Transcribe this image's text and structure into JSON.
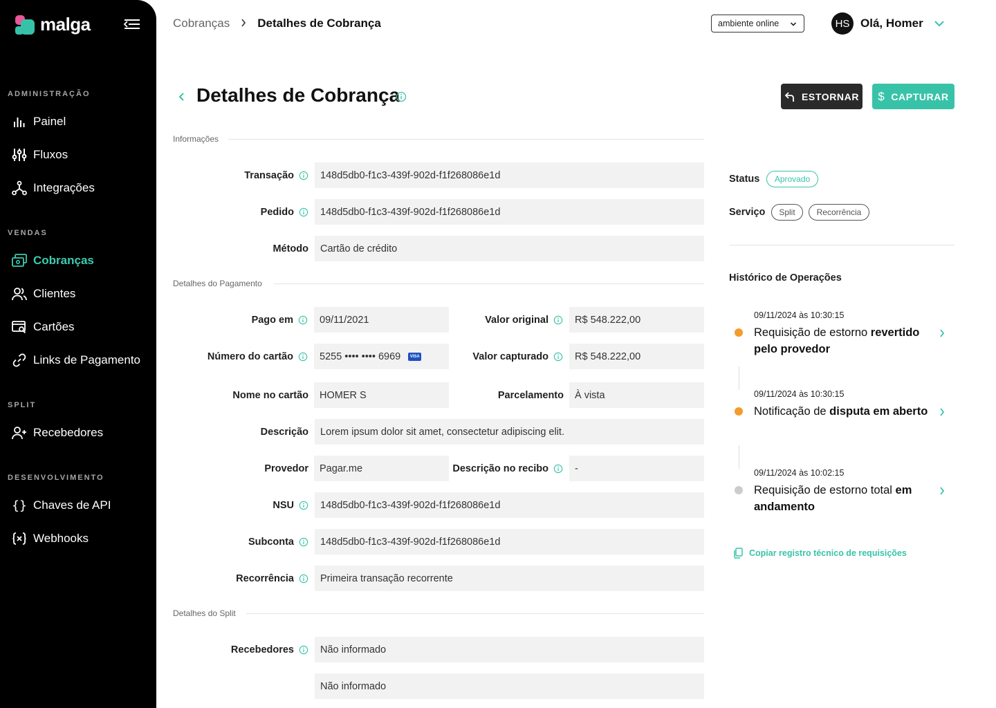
{
  "app": {
    "logo_text": "malga"
  },
  "sidebar": {
    "sections": [
      {
        "label": "ADMINISTRAÇÃO"
      },
      {
        "label": "VENDAS"
      },
      {
        "label": "SPLIT"
      },
      {
        "label": "DESENVOLVIMENTO"
      }
    ],
    "items": [
      {
        "label": "Painel",
        "icon": "bar-chart-icon"
      },
      {
        "label": "Fluxos",
        "icon": "sliders-icon"
      },
      {
        "label": "Integrações",
        "icon": "integrations-icon"
      },
      {
        "label": "Cobranças",
        "icon": "charges-icon",
        "active": true
      },
      {
        "label": "Clientes",
        "icon": "users-icon"
      },
      {
        "label": "Cartões",
        "icon": "card-search-icon"
      },
      {
        "label": "Links de Pagamento",
        "icon": "link-icon"
      },
      {
        "label": "Recebedores",
        "icon": "user-plus-icon"
      },
      {
        "label": "Chaves de API",
        "icon": "braces-icon"
      },
      {
        "label": "Webhooks",
        "icon": "webhook-icon"
      }
    ]
  },
  "header": {
    "breadcrumb": {
      "parent": "Cobranças",
      "current": "Detalhes de Cobrança"
    },
    "environment": "ambiente online",
    "user": {
      "initials": "HS",
      "greeting": "Olá, Homer"
    }
  },
  "page": {
    "title": "Detalhes de Cobrança",
    "actions": {
      "estornar": "ESTORNAR",
      "capturar": "CAPTURAR"
    }
  },
  "info": {
    "section_title": "Informações",
    "transacao": {
      "label": "Transação",
      "value": "148d5db0-f1c3-439f-902d-f1f268086e1d"
    },
    "pedido": {
      "label": "Pedido",
      "value": "148d5db0-f1c3-439f-902d-f1f268086e1d"
    },
    "metodo": {
      "label": "Método",
      "value": "Cartão de crédito"
    }
  },
  "payment": {
    "section_title": "Detalhes do Pagamento",
    "pago_em": {
      "label": "Pago em",
      "value": "09/11/2021"
    },
    "valor_original": {
      "label": "Valor original",
      "value": "R$ 548.222,00"
    },
    "numero_cartao": {
      "label": "Número do cartão",
      "value": "5255 •••• •••• 6969",
      "brand": "VISA"
    },
    "valor_capturado": {
      "label": "Valor capturado",
      "value": "R$ 548.222,00"
    },
    "nome_cartao": {
      "label": "Nome no cartão",
      "value": "HOMER S"
    },
    "parcelamento": {
      "label": "Parcelamento",
      "value": "À vista"
    },
    "descricao": {
      "label": "Descrição",
      "value": "Lorem ipsum dolor sit amet, consectetur adipiscing elit."
    },
    "provedor": {
      "label": "Provedor",
      "value": "Pagar.me"
    },
    "descricao_recibo": {
      "label": "Descrição no recibo",
      "value": "-"
    },
    "nsu": {
      "label": "NSU",
      "value": "148d5db0-f1c3-439f-902d-f1f268086e1d"
    },
    "subconta": {
      "label": "Subconta",
      "value": "148d5db0-f1c3-439f-902d-f1f268086e1d"
    },
    "recorrencia": {
      "label": "Recorrência",
      "value": "Primeira transação recorrente"
    }
  },
  "split": {
    "section_title": "Detalhes do Split",
    "recebedores": {
      "label": "Recebedores",
      "values": [
        "Não informado",
        "Não informado"
      ]
    }
  },
  "status_panel": {
    "status_label": "Status",
    "status_value": "Aprovado",
    "servico_label": "Serviço",
    "services": [
      "Split",
      "Recorrência"
    ]
  },
  "history": {
    "title": "Histórico de Operações",
    "items": [
      {
        "time": "09/11/2024 às 10:30:15",
        "text_normal": "Requisição de estorno ",
        "text_bold": "revertido pelo provedor",
        "dot_color": "#f39c2b"
      },
      {
        "time": "09/11/2024 às 10:30:15",
        "text_normal": "Notificação de ",
        "text_bold": "disputa em aberto",
        "dot_color": "#f39c2b"
      },
      {
        "time": "09/11/2024 às 10:02:15",
        "text_normal": "Requisição de estorno total ",
        "text_bold": "em andamento",
        "dot_color": "#cccccc"
      }
    ],
    "copy_link": "Copiar registro técnico de requisições"
  },
  "colors": {
    "accent": "#38c3a8",
    "sidebar_bg": "#000000",
    "warning": "#f39c2b"
  }
}
